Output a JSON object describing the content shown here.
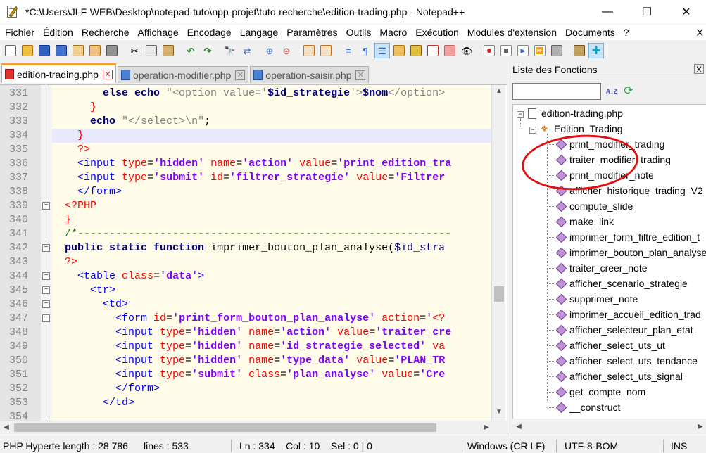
{
  "window": {
    "title": "*C:\\Users\\JLF-WEB\\Desktop\\notepad-tuto\\npp-projet\\tuto-recherche\\edition-trading.php - Notepad++",
    "minimize": "—",
    "maximize": "☐",
    "close": "✕"
  },
  "menu": [
    "Fichier",
    "Édition",
    "Recherche",
    "Affichage",
    "Encodage",
    "Langage",
    "Paramètres",
    "Outils",
    "Macro",
    "Exécution",
    "Modules d'extension",
    "Documents",
    "?"
  ],
  "menu_close": "X",
  "tabs": [
    {
      "label": "edition-trading.php",
      "active": true
    },
    {
      "label": "operation-modifier.php",
      "active": false
    },
    {
      "label": "operation-saisir.php",
      "active": false
    }
  ],
  "tab_close": "✕",
  "editor": {
    "line_numbers": [
      "331",
      "332",
      "333",
      "334",
      "335",
      "336",
      "337",
      "338",
      "339",
      "340",
      "341",
      "342",
      "343",
      "344",
      "345",
      "346",
      "347",
      "348",
      "349",
      "350",
      "351",
      "352",
      "353",
      "354"
    ],
    "current_line": "334"
  },
  "function_list": {
    "title": "Liste des Fonctions",
    "close": "X",
    "file": "edition-trading.php",
    "class": "Edition_Trading",
    "functions": [
      "print_modifier_trading",
      "traiter_modifier_trading",
      "print_modifier_note",
      "afficher_historique_trading_V2",
      "compute_slide",
      "make_link",
      "imprimer_form_filtre_edition_t",
      "imprimer_bouton_plan_analyse",
      "traiter_creer_note",
      "afficher_scenario_strategie",
      "supprimer_note",
      "imprimer_accueil_edition_trad",
      "afficher_selecteur_plan_etat",
      "afficher_select_uts_ut",
      "afficher_select_uts_tendance",
      "afficher_select_uts_signal",
      "get_compte_nom",
      "__construct"
    ],
    "sort_icon": "A↓Z",
    "reload_icon": "⟳"
  },
  "status": {
    "lang": "PHP Hyperte length : 28 786",
    "lines": "lines : 533",
    "ln": "Ln : 334",
    "col": "Col : 10",
    "sel": "Sel : 0 | 0",
    "eol": "Windows (CR LF)",
    "encoding": "UTF-8-BOM",
    "mode": "INS"
  },
  "colors": {
    "keyword": "#000080",
    "attribute": "#ff0000",
    "attr_value": "#8000ff",
    "tag": "#0000ff",
    "comment": "#008000",
    "active_tab_accent": "#f0a030",
    "annotation_circle": "#e01010"
  }
}
